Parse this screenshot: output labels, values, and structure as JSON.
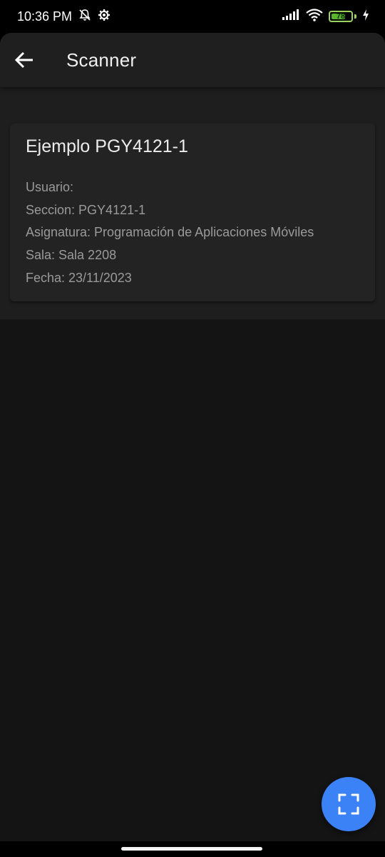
{
  "status_bar": {
    "time": "10:36 PM",
    "icons": [
      "mute-bell-icon",
      "settings-gear-icon",
      "signal-icon",
      "wifi-icon",
      "battery-icon",
      "charging-bolt-icon"
    ],
    "battery_level": "78",
    "battery_fraction": 0.78,
    "battery_color": "#5ab52c"
  },
  "toolbar": {
    "title": "Scanner",
    "back_icon": "arrow-left-icon"
  },
  "card": {
    "title": "Ejemplo PGY4121-1",
    "usuario": "Usuario:",
    "seccion": "Seccion: PGY4121-1",
    "asignatura": "Asignatura: Programación de Aplicaciones Móviles",
    "sala": "Sala: Sala 2208",
    "fecha": "Fecha: 23/11/2023"
  },
  "fab": {
    "icon": "scan-icon",
    "color": "#3b82f6"
  },
  "colors": {
    "background": "#141414",
    "toolbar": "#1f1f1f",
    "card": "#232323",
    "accent": "#3b82f6"
  }
}
